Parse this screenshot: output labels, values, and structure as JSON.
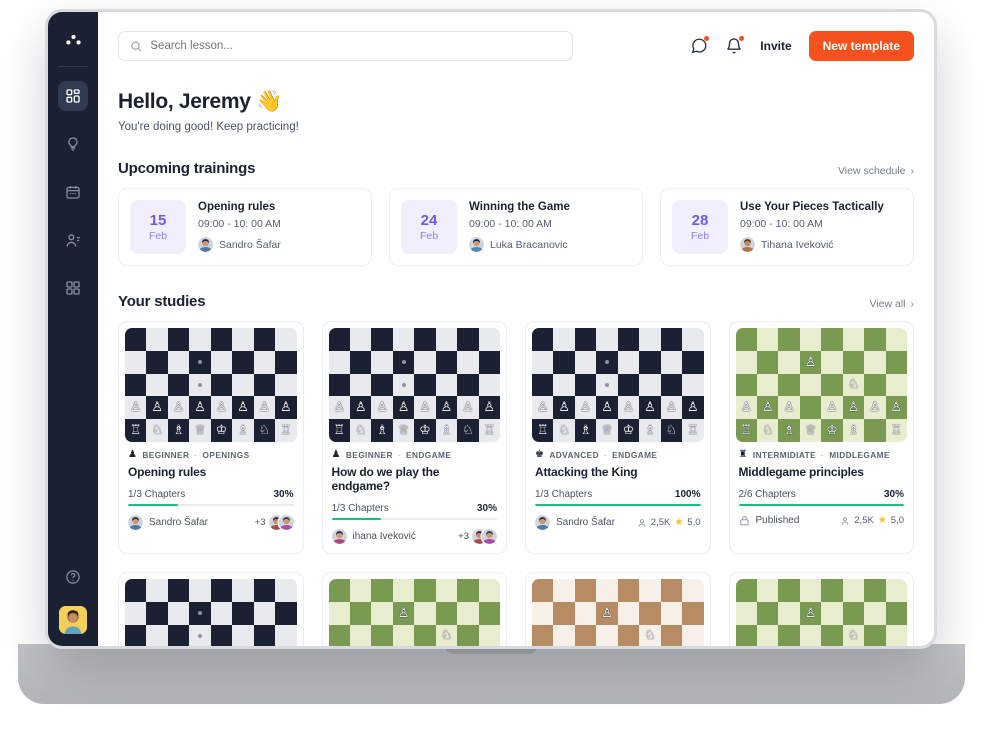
{
  "app": {
    "accent": "#f4511e",
    "purple": "#6c5ce7",
    "green": "#13c27b",
    "sidebar_bg": "#1b2132"
  },
  "sidebar": {
    "logo_name": "app-logo",
    "items": [
      {
        "name": "dashboard",
        "icon": "dashboard-icon",
        "active": true
      },
      {
        "name": "insights",
        "icon": "lightbulb-icon",
        "active": false
      },
      {
        "name": "calendar",
        "icon": "calendar-icon",
        "active": false
      },
      {
        "name": "students",
        "icon": "people-icon",
        "active": false
      },
      {
        "name": "apps",
        "icon": "grid-icon",
        "active": false
      }
    ],
    "help_icon": "help-circle-icon",
    "avatar_name": "user-avatar"
  },
  "search": {
    "placeholder": "Search lesson...",
    "value": "",
    "icon": "search-icon"
  },
  "topbar": {
    "chat_icon": "chat-bubble-icon",
    "bell_icon": "bell-icon",
    "invite_label": "Invite",
    "new_template_label": "New template",
    "has_chat_notification": true,
    "has_bell_notification": true
  },
  "greeting": {
    "title": "Hello, Jeremy",
    "emoji": "👋",
    "subtitle": "You're doing good! Keep practicing!"
  },
  "trainings_section": {
    "title": "Upcoming trainings",
    "link_label": "View schedule",
    "chevron": "›",
    "cards": [
      {
        "day": "15",
        "month": "Feb",
        "title": "Opening rules",
        "time": "09:00 - 10: 00 AM",
        "person": "Sandro Šafar",
        "avatar_hue": 210
      },
      {
        "day": "24",
        "month": "Feb",
        "title": "Winning the Game",
        "time": "09:00 - 10: 00 AM",
        "person": "Luka Bracanovic",
        "avatar_hue": 200
      },
      {
        "day": "28",
        "month": "Feb",
        "title": "Use Your Pieces Tactically",
        "time": "09:00 - 10: 00 AM",
        "person": "Tihana Iveković",
        "avatar_hue": 25
      }
    ]
  },
  "studies_section": {
    "title": "Your studies",
    "link_label": "View all",
    "chevron": "›",
    "cards": [
      {
        "board_theme": "navy",
        "level": "BEGINNER",
        "level_icon": "pawn-icon",
        "category": "OPENINGS",
        "title": "Opening rules",
        "chapters": "1/3 Chapters",
        "percent": "30%",
        "progress": 30,
        "footer_type": "author",
        "author": "Sandro Šafar",
        "extra_count": "+3"
      },
      {
        "board_theme": "navy",
        "level": "BEGINNER",
        "level_icon": "pawn-icon",
        "category": "ENDGAME",
        "title": "How do we play the endgame?",
        "chapters": "1/3 Chapters",
        "percent": "30%",
        "progress": 30,
        "footer_type": "author",
        "author": "ihana Iveković",
        "extra_count": "+3"
      },
      {
        "board_theme": "navy",
        "level": "ADVANCED",
        "level_icon": "king-icon",
        "category": "ENDGAME",
        "title": "Attacking the King",
        "chapters": "1/3 Chapters",
        "percent": "100%",
        "progress": 100,
        "footer_type": "author-stats",
        "author": "Sandro Šafar",
        "views": "2,5K",
        "rating": "5,0"
      },
      {
        "board_theme": "green",
        "level": "INTERMIDIATE",
        "level_icon": "rook-icon",
        "category": "MIDDLEGAME",
        "title": "Middlegame principles",
        "chapters": "2/6 Chapters",
        "percent": "30%",
        "progress": 100,
        "footer_type": "published-stats",
        "published_label": "Published",
        "views": "2,5K",
        "rating": "5,0"
      }
    ],
    "second_row_boards": [
      "navy",
      "green",
      "brown",
      "green"
    ]
  }
}
